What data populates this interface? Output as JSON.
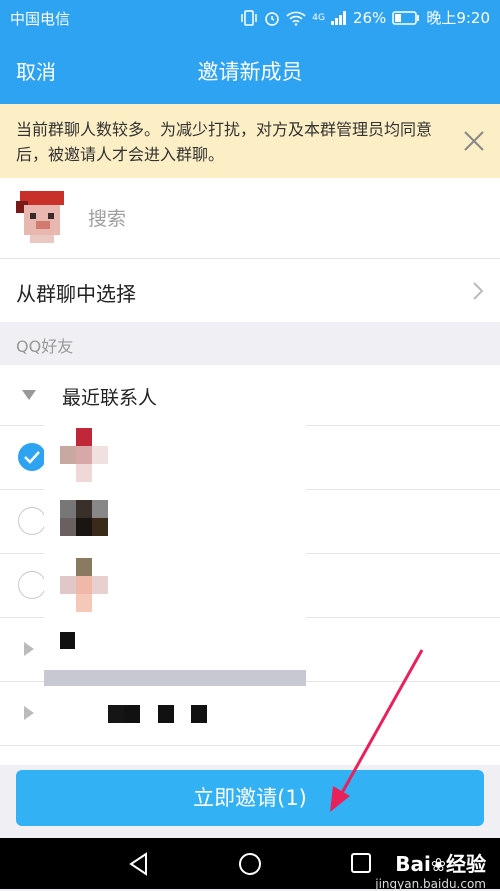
{
  "status_bar": {
    "carrier": "中国电信",
    "signal": "4G",
    "battery": "26%",
    "time": "晚上9:20"
  },
  "header": {
    "cancel_label": "取消",
    "title": "邀请新成员"
  },
  "notice": {
    "text": "当前群聊人数较多。为减少打扰，对方及本群管理员均同意后，被邀请人才会进入群聊。"
  },
  "search": {
    "placeholder": "搜索"
  },
  "group_select": {
    "label": "从群聊中选择"
  },
  "section": {
    "label": "QQ好友"
  },
  "recent": {
    "label": "最近联系人"
  },
  "contacts": [
    {
      "checked": true
    },
    {
      "checked": false
    },
    {
      "checked": false
    }
  ],
  "invite_button": {
    "label": "立即邀请(1)"
  },
  "watermark": {
    "brand": "Bai",
    "sub": "经验",
    "url": "jingyan.baidu.com"
  },
  "colors": {
    "primary": "#2ea3f2",
    "button": "#32b1f5",
    "notice_bg": "#fcefc6",
    "arrow": "#e8215a"
  }
}
